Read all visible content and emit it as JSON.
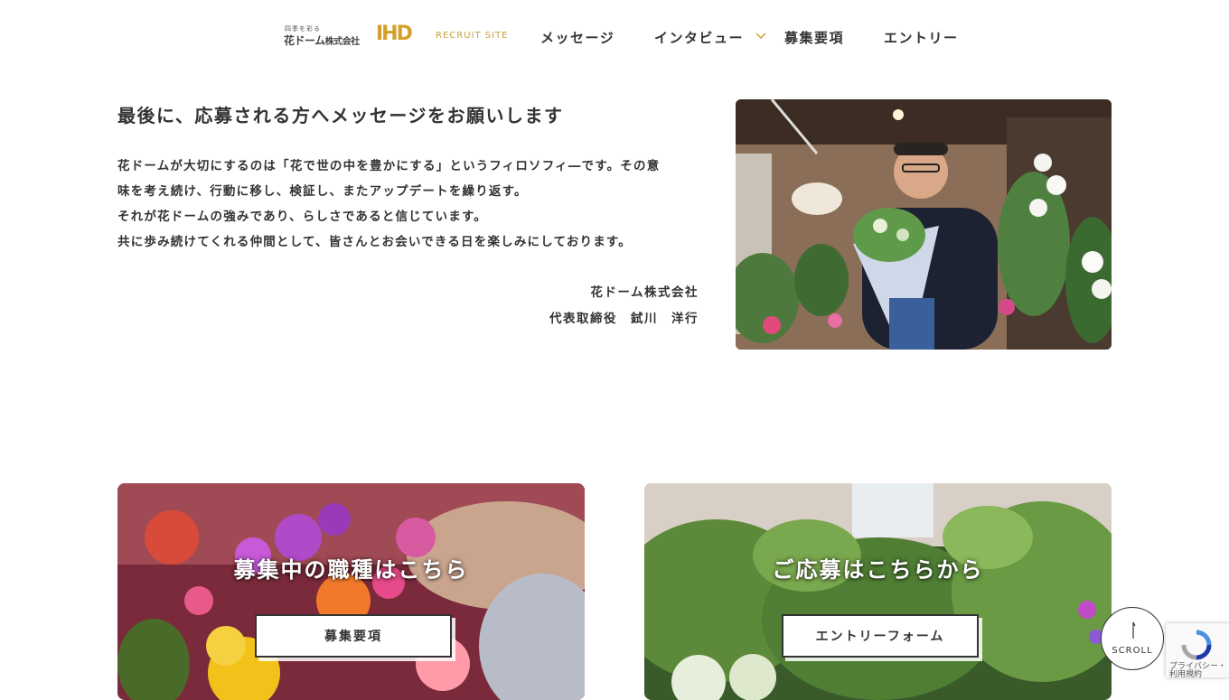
{
  "header": {
    "logo": {
      "tagline": "四季を彩る",
      "company_main": "花ドーム",
      "company_suffix": "株式会社",
      "mark": "IHD",
      "sub": "RECRUIT SITE"
    },
    "nav": {
      "message": "メッセージ",
      "interview": "インタビュー",
      "recruitment": "募集要項",
      "entry": "エントリー"
    }
  },
  "message": {
    "title": "最後に、応募される方へメッセージをお願いします",
    "lines": [
      "花ドームが大切にするのは「花で世の中を豊かにする」というフィロソフィ―です。その意",
      "味を考え続け、行動に移し、検証し、またアップデートを繰り返す。",
      "それが花ドームの強みであり、らしさであると信じています。",
      "共に歩み続けてくれる仲間として、皆さんとお会いできる日を楽しみにしております。"
    ],
    "signature_company": "花ドーム株式会社",
    "signature_name": "代表取締役　鉽川　洋行"
  },
  "cards": {
    "left": {
      "title": "募集中の職種はこちら",
      "button": "募集要項"
    },
    "right": {
      "title": "ご応募はこちらから",
      "button": "エントリーフォーム"
    }
  },
  "scroll": {
    "label": "SCROLL"
  },
  "recaptcha": {
    "line1": "プライバシー・",
    "line2": "利用規約"
  },
  "colors": {
    "accent_gold": "#d4a02a",
    "text": "#333333"
  }
}
